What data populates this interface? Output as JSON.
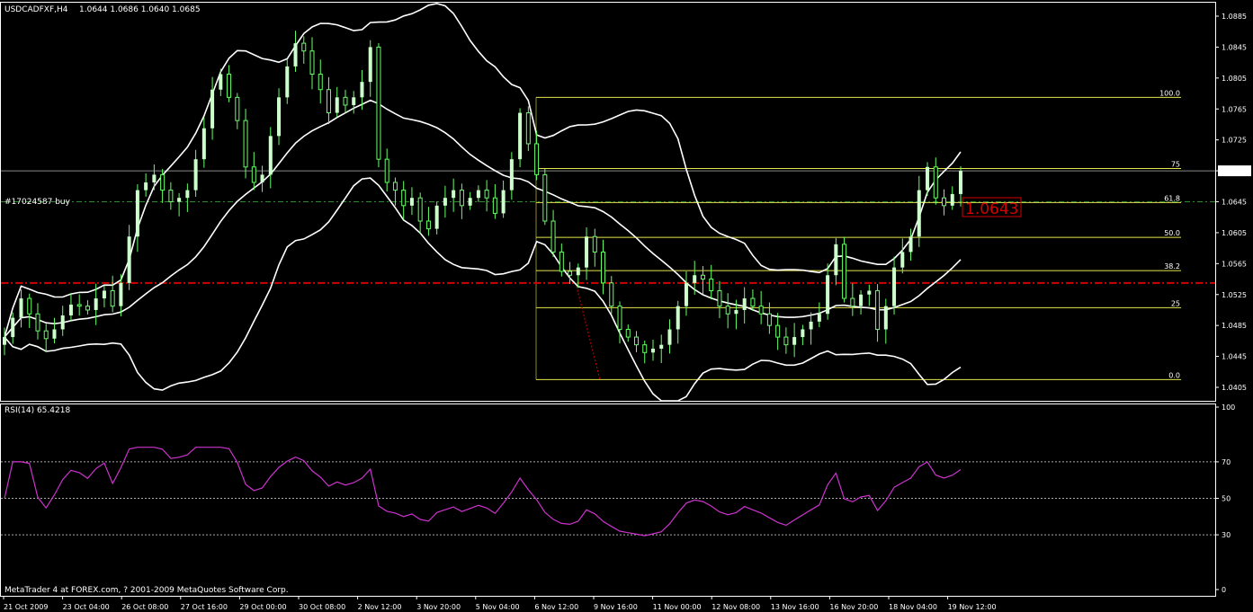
{
  "chart_data": [
    {
      "type": "candlestick",
      "title": "USDCADFXF,H4",
      "ohlc_header": "1.0644 1.0686 1.0640 1.0685",
      "ylim": [
        1.0395,
        1.091
      ],
      "y_ticks": [
        "1.0885",
        "1.0845",
        "1.0805",
        "1.0765",
        "1.0725",
        "1.0685",
        "1.0645",
        "1.0605",
        "1.0565",
        "1.0525",
        "1.0485",
        "1.0445",
        "1.0405"
      ],
      "current_price_label": "1.0685",
      "order_label": "#17024587 buy",
      "order_price": 1.0645,
      "stop_line_price": 1.054,
      "crosshair_value": "1.0643",
      "fibonacci": [
        {
          "label": "100.0",
          "value": 1.078
        },
        {
          "label": "75",
          "value": 1.0688
        },
        {
          "label": "61.8",
          "value": 1.0644
        },
        {
          "label": "50.0",
          "value": 1.0599
        },
        {
          "label": "38.2",
          "value": 1.0556
        },
        {
          "label": "25",
          "value": 1.0508
        },
        {
          "label": "0.0",
          "value": 1.0415
        }
      ],
      "close": [
        1.047,
        1.0495,
        1.052,
        1.05,
        1.0478,
        1.0468,
        1.048,
        1.0498,
        1.0512,
        1.051,
        1.0505,
        1.052,
        1.053,
        1.051,
        1.054,
        1.06,
        1.066,
        1.067,
        1.068,
        1.066,
        1.0645,
        1.065,
        1.066,
        1.07,
        1.074,
        1.079,
        1.081,
        1.078,
        1.075,
        1.069,
        1.067,
        1.068,
        1.073,
        1.078,
        1.082,
        1.085,
        1.084,
        1.081,
        1.079,
        1.076,
        1.078,
        1.077,
        1.078,
        1.08,
        1.0845,
        1.07,
        1.067,
        1.066,
        1.064,
        1.065,
        1.062,
        1.061,
        1.064,
        1.065,
        1.066,
        1.064,
        1.065,
        1.066,
        1.065,
        1.063,
        1.066,
        1.07,
        1.076,
        1.072,
        1.068,
        1.062,
        1.058,
        1.0555,
        1.055,
        1.056,
        1.06,
        1.058,
        1.054,
        1.051,
        1.048,
        1.047,
        1.046,
        1.045,
        1.0455,
        1.046,
        1.048,
        1.051,
        1.054,
        1.055,
        1.0545,
        1.053,
        1.051,
        1.05,
        1.0505,
        1.052,
        1.051,
        1.05,
        1.0485,
        1.047,
        1.046,
        1.047,
        1.048,
        1.049,
        1.05,
        1.055,
        1.059,
        1.052,
        1.051,
        1.0525,
        1.053,
        1.048,
        1.051,
        1.056,
        1.058,
        1.06,
        1.066,
        1.069,
        1.065,
        1.064,
        1.0655,
        1.0685
      ],
      "indicators": [
        "Bollinger Bands (upper / middle / lower)"
      ]
    },
    {
      "type": "line",
      "title": "RSI(14) 65.4218",
      "ylim": [
        0,
        100
      ],
      "y_ticks": [
        "100",
        "70",
        "50",
        "30",
        "0"
      ],
      "levels": [
        70,
        50,
        30
      ],
      "series": [
        {
          "values": []
        }
      ]
    }
  ],
  "x_labels": [
    "21 Oct 2009",
    "23 Oct 04:00",
    "26 Oct 08:00",
    "27 Oct 16:00",
    "29 Oct 00:00",
    "30 Oct 08:00",
    "2 Nov 12:00",
    "3 Nov 20:00",
    "5 Nov 04:00",
    "6 Nov 12:00",
    "9 Nov 16:00",
    "11 Nov 00:00",
    "12 Nov 08:00",
    "13 Nov 16:00",
    "16 Nov 20:00",
    "18 Nov 04:00",
    "19 Nov 12:00"
  ],
  "footer": "MetaTrader 4 at FOREX.com, ? 2001-2009 MetaQuotes Software Corp.",
  "colors": {
    "background": "#000000",
    "candle_up": "#ccffcc",
    "candle_wick": "#66ff66",
    "bands": "#ffffff",
    "fib": "#e5e54c",
    "order_line": "#2e8b2e",
    "stop_line": "#d40000",
    "rsi": "#cc33cc",
    "axis": "#ffffff"
  }
}
